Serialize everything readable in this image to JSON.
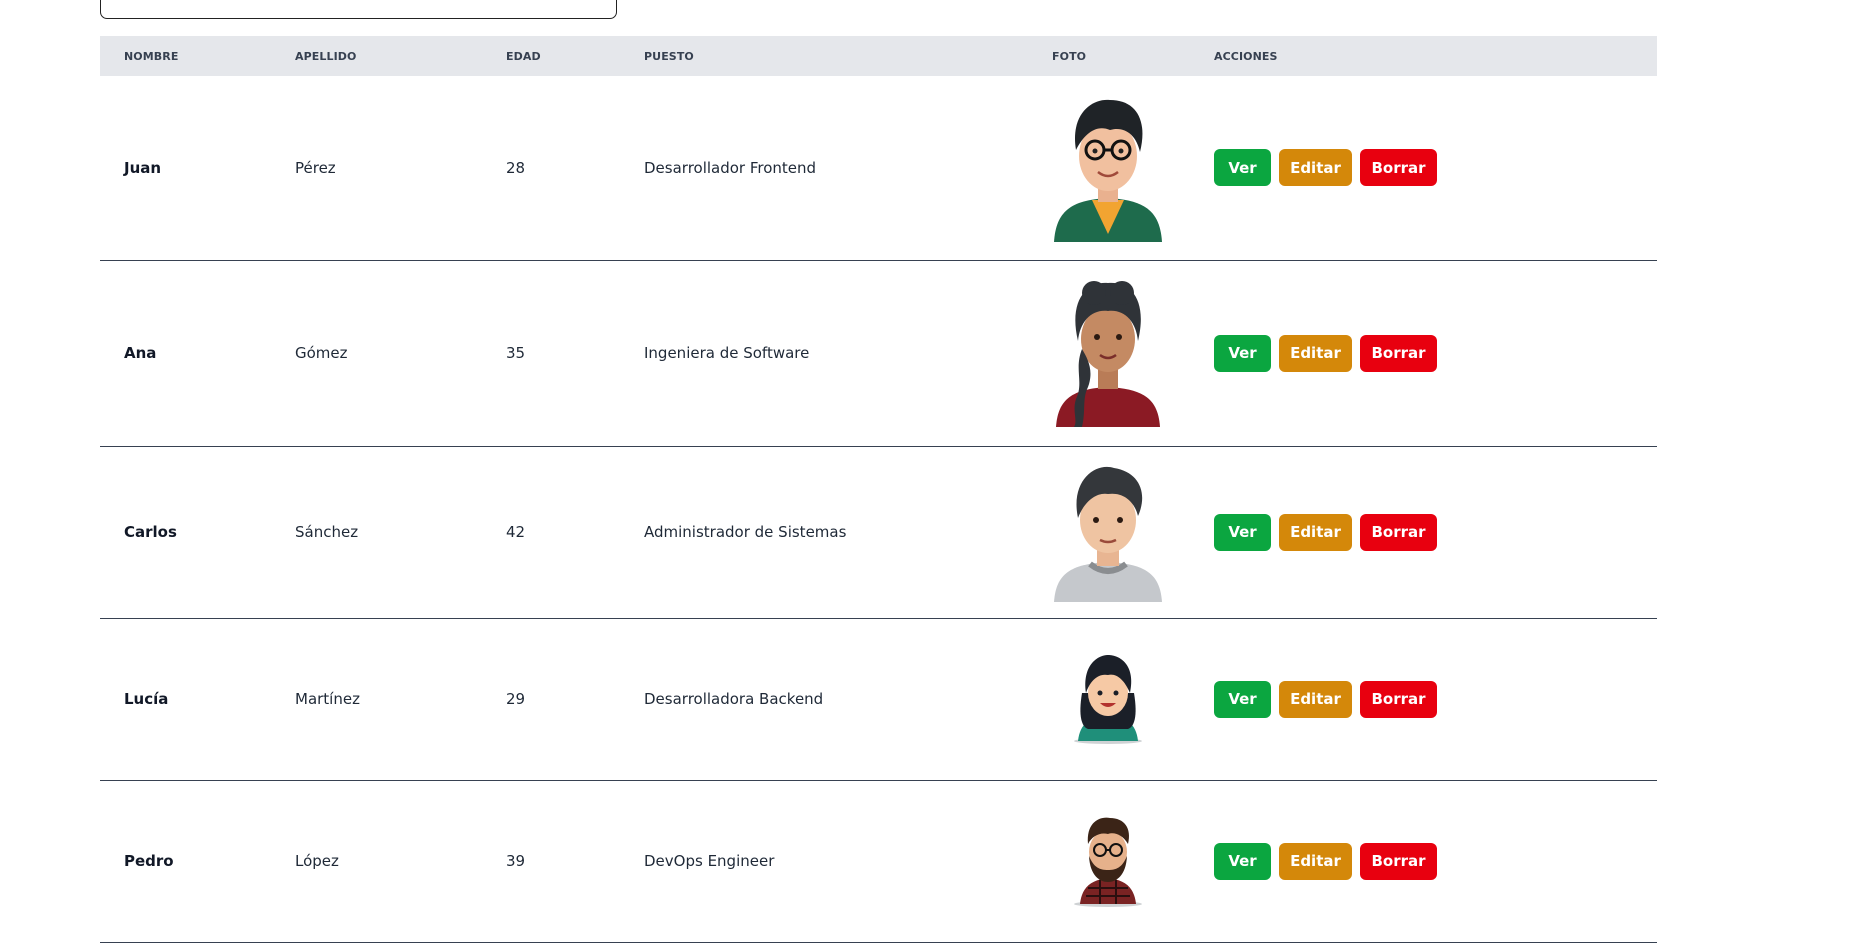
{
  "search": {
    "value": ""
  },
  "colors": {
    "header_bg": "#e5e7eb",
    "ver": "#0ba640",
    "editar": "#d4880a",
    "borrar": "#e8000f"
  },
  "table": {
    "columns": [
      "NOMBRE",
      "APELLIDO",
      "EDAD",
      "PUESTO",
      "FOTO",
      "ACCIONES"
    ],
    "rows": [
      {
        "nombre": "Juan",
        "apellido": "Pérez",
        "edad": "28",
        "puesto": "Desarrollador Frontend",
        "foto": "avatar-young-man-glasses-green-hoodie"
      },
      {
        "nombre": "Ana",
        "apellido": "Gómez",
        "edad": "35",
        "puesto": "Ingeniera de Software",
        "foto": "avatar-woman-braid-red-shirt"
      },
      {
        "nombre": "Carlos",
        "apellido": "Sánchez",
        "edad": "42",
        "puesto": "Administrador de Sistemas",
        "foto": "avatar-man-gray-shirt"
      },
      {
        "nombre": "Lucía",
        "apellido": "Martínez",
        "edad": "29",
        "puesto": "Desarrolladora Backend",
        "foto": "avatar-woman-teal-shirt"
      },
      {
        "nombre": "Pedro",
        "apellido": "López",
        "edad": "39",
        "puesto": "DevOps Engineer",
        "foto": "avatar-bearded-man-plaid-shirt"
      }
    ]
  },
  "actions": {
    "ver": "Ver",
    "editar": "Editar",
    "borrar": "Borrar"
  }
}
